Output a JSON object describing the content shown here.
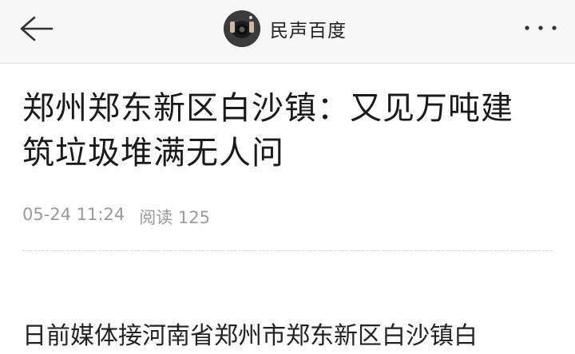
{
  "header": {
    "author_name": "民声百度"
  },
  "article": {
    "title": "郑州郑东新区白沙镇：又见万吨建筑垃圾堆满无人问",
    "date": "05-24 11:24",
    "reads": "阅读 125",
    "body_first_line": "日前媒体接河南省郑州市郑东新区白沙镇白"
  },
  "icons": {
    "back": "arrow-left-icon",
    "more": "more-dots-icon"
  },
  "colors": {
    "header_bg": "#f7f7f7",
    "title_text": "#1a1a1a",
    "meta_text": "#9a9a9a"
  }
}
